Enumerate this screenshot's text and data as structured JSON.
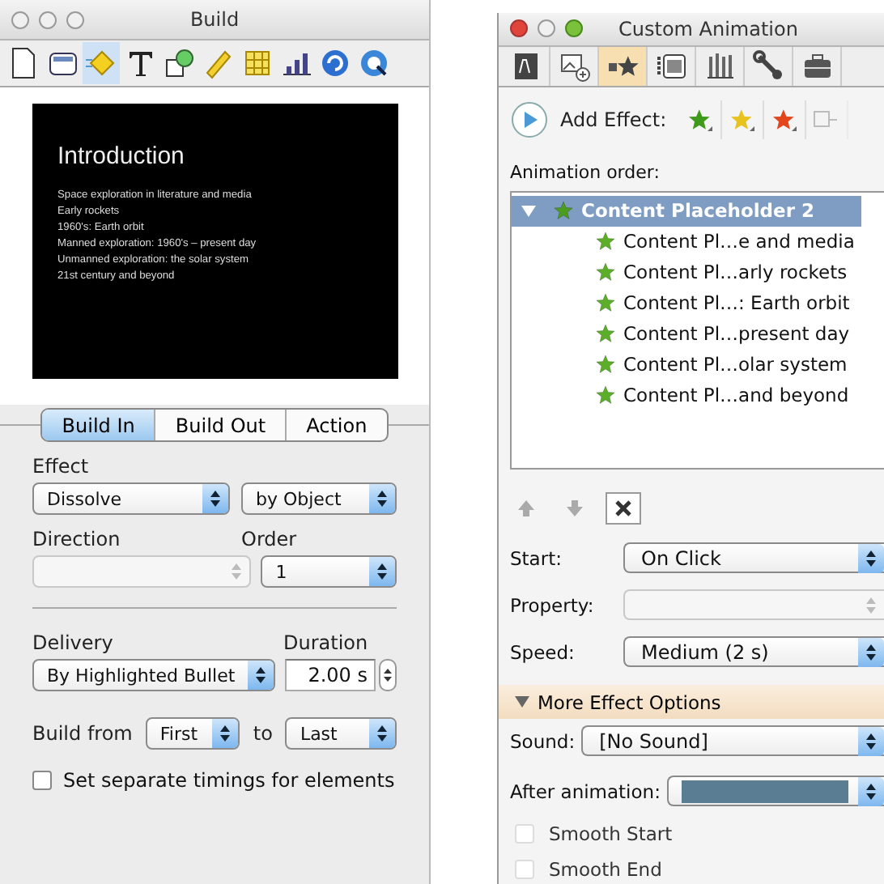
{
  "build_window": {
    "title": "Build",
    "toolbar": [
      {
        "kind": "document",
        "selected": false
      },
      {
        "kind": "slide",
        "selected": false
      },
      {
        "kind": "build",
        "selected": true
      },
      {
        "kind": "text",
        "selected": false
      },
      {
        "kind": "shape",
        "selected": false
      },
      {
        "kind": "ruler",
        "selected": false
      },
      {
        "kind": "table",
        "selected": false
      },
      {
        "kind": "chart",
        "selected": false
      },
      {
        "kind": "link",
        "selected": false
      },
      {
        "kind": "media",
        "selected": false
      }
    ],
    "slide": {
      "title": "Introduction",
      "bullets": [
        "Space exploration in literature and media",
        "Early rockets",
        "1960's: Earth orbit",
        "Manned exploration: 1960's – present day",
        "Unmanned exploration: the solar system",
        "21st century and beyond"
      ]
    },
    "tabs": [
      {
        "label": "Build In",
        "selected": true
      },
      {
        "label": "Build Out",
        "selected": false
      },
      {
        "label": "Action",
        "selected": false
      }
    ],
    "effect": {
      "label": "Effect",
      "value": "Dissolve",
      "delivery": "by Object"
    },
    "direction": {
      "label": "Direction",
      "disabled": true
    },
    "order": {
      "label": "Order",
      "value": "1"
    },
    "delivery": {
      "label": "Delivery",
      "value": "By Highlighted Bullet"
    },
    "duration": {
      "label": "Duration",
      "value": "2.00 s"
    },
    "build_from": {
      "label": "Build from",
      "from": "First",
      "to_label": "to",
      "to": "Last"
    },
    "separate_timings": {
      "label": "Set separate timings for elements",
      "checked": false
    }
  },
  "animation_window": {
    "title": "Custom Animation",
    "toolbar": [
      {
        "kind": "formatting",
        "selected": false
      },
      {
        "kind": "picture",
        "selected": false
      },
      {
        "kind": "animation",
        "selected": true
      },
      {
        "kind": "media",
        "selected": false
      },
      {
        "kind": "data",
        "selected": false
      },
      {
        "kind": "wrench",
        "selected": false
      },
      {
        "kind": "briefcase",
        "selected": false
      }
    ],
    "add_effect": {
      "label": "Add Effect:",
      "effects": [
        {
          "kind": "star",
          "color": "#3f9a1c",
          "disabled": false
        },
        {
          "kind": "star",
          "color": "#e8c21e",
          "disabled": false
        },
        {
          "kind": "star",
          "color": "#e2461a",
          "disabled": false
        },
        {
          "kind": "path",
          "disabled": true
        }
      ]
    },
    "order_label": "Animation order:",
    "animation_list": [
      {
        "label": "Content Placeholder 2",
        "expanded": true,
        "selected": true,
        "children": [
          {
            "label": "Content Pl…e and media",
            "selected": false
          },
          {
            "label": "Content Pl…arly rockets",
            "selected": false
          },
          {
            "label": "Content Pl…: Earth orbit",
            "selected": false
          },
          {
            "label": "Content Pl…present day",
            "selected": false
          },
          {
            "label": "Content Pl…olar system",
            "selected": false
          },
          {
            "label": "Content Pl…and beyond",
            "selected": false
          }
        ]
      }
    ],
    "list_buttons": [
      {
        "kind": "up",
        "disabled": true
      },
      {
        "kind": "down",
        "disabled": true
      },
      {
        "kind": "delete",
        "disabled": false
      }
    ],
    "fields": [
      {
        "label": "Start:",
        "value": "On Click",
        "disabled": false
      },
      {
        "label": "Property:",
        "disabled": true
      },
      {
        "label": "Speed:",
        "value": "Medium (2 s)",
        "disabled": false
      }
    ],
    "more_options": {
      "label": "More Effect Options",
      "expanded": true,
      "sound": {
        "label": "Sound:",
        "value": "[No Sound]"
      },
      "after_animation": {
        "label": "After animation:",
        "color": "#5b7d93"
      },
      "options": [
        {
          "label": "Smooth Start",
          "checked": false,
          "disabled": true
        },
        {
          "label": "Smooth End",
          "checked": false,
          "disabled": true
        }
      ]
    }
  }
}
